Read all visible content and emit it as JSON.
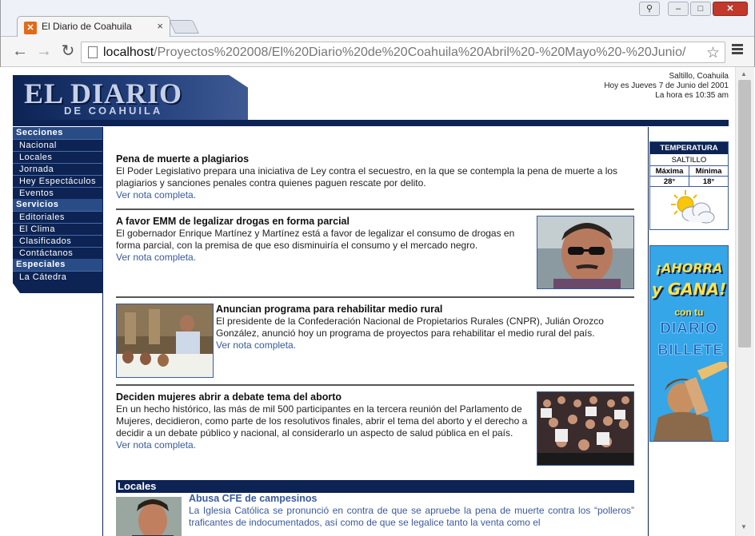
{
  "browser": {
    "tab_title": "El Diario de Coahuila",
    "tab_favicon": "xampp-icon",
    "tab_close": "×",
    "url_host": "localhost",
    "url_path": "/Proyectos%202008/El%20Diario%20de%20Coahuila%20Abril%20-%20Mayo%20-%20Junio/",
    "back_glyph": "←",
    "forward_glyph": "→",
    "reload_glyph": "↻",
    "star_glyph": "☆",
    "win_min": "–",
    "win_max": "□",
    "win_close": "✕",
    "win_user": "⚲"
  },
  "header": {
    "logo_main": "EL DIARIO",
    "logo_sub": "DE COAHUILA",
    "city": "Saltillo, Coahuila",
    "date_line": "Hoy es Jueves 7 de Junio del 2001",
    "time_line": "La hora es 10:35 am"
  },
  "nav": {
    "sections": [
      {
        "title": "Secciones",
        "items": [
          "Nacional",
          "Locales",
          "Jornada",
          "Hey Espectáculos",
          "Eventos"
        ]
      },
      {
        "title": "Servicios",
        "items": [
          "Editoriales",
          "El Clima",
          "Clasificados",
          "Contáctanos"
        ]
      },
      {
        "title": "Especiales",
        "items": [
          "La Cátedra"
        ]
      }
    ]
  },
  "articles": [
    {
      "title": "Pena de muerte a plagiarios",
      "body": "El Poder Legislativo prepara una iniciativa de Ley contra el secuestro, en la que se contempla la pena de muerte a los plagiarios y sanciones penales contra quienes paguen rescate por delito.",
      "more": "Ver nota completa."
    },
    {
      "title": "A favor EMM de legalizar drogas en forma parcial",
      "body": "El gobernador Enrique Martínez y Martínez está a favor de legalizar el consumo de drogas en forma parcial, con la premisa de que eso disminuiría el consumo y el mercado negro.",
      "more": "Ver nota completa."
    },
    {
      "title": "Anuncian programa para rehabilitar medio rural",
      "body": "El presidente de la Confederación Nacional de Propietarios Rurales (CNPR), Julián Orozco González, anunció hoy un programa de proyectos para rehabilitar el medio rural del país.",
      "more": "Ver nota completa."
    },
    {
      "title": "Deciden mujeres abrir a debate tema del aborto",
      "body": "En un hecho histórico, las más de mil 500 participantes en la tercera reunión del Parlamento de Mujeres, decidieron, como parte de los resolutivos finales, abrir el tema del aborto y el derecho a decidir a un debate público y nacional, al considerarlo un aspecto de salud pública en el país.",
      "more": "Ver nota completa."
    }
  ],
  "locales": {
    "section_title": "Locales",
    "title": "Abusa CFE de campesinos",
    "body": "La Iglesia Católica se pronunció en contra de que se apruebe la pena de muerte contra los “polleros” traficantes de indocumentados, así como de que se legalice tanto la venta como el"
  },
  "weather": {
    "title": "TEMPERATURA",
    "city": "SALTILLO",
    "max_label": "Máxima",
    "min_label": "Mínima",
    "max_value": "28°",
    "min_value": "18°",
    "icon": "partly-cloudy-icon"
  },
  "banner": {
    "line1": "¡AHORRA",
    "line2": "y GANA!",
    "line3": "con tu",
    "line4": "DIARIO",
    "line5": "BILLETE"
  },
  "colors": {
    "navy": "#0c2354",
    "link": "#3a5a9c",
    "banner_bg": "#35a6e8",
    "banner_yellow": "#ffe24a"
  }
}
